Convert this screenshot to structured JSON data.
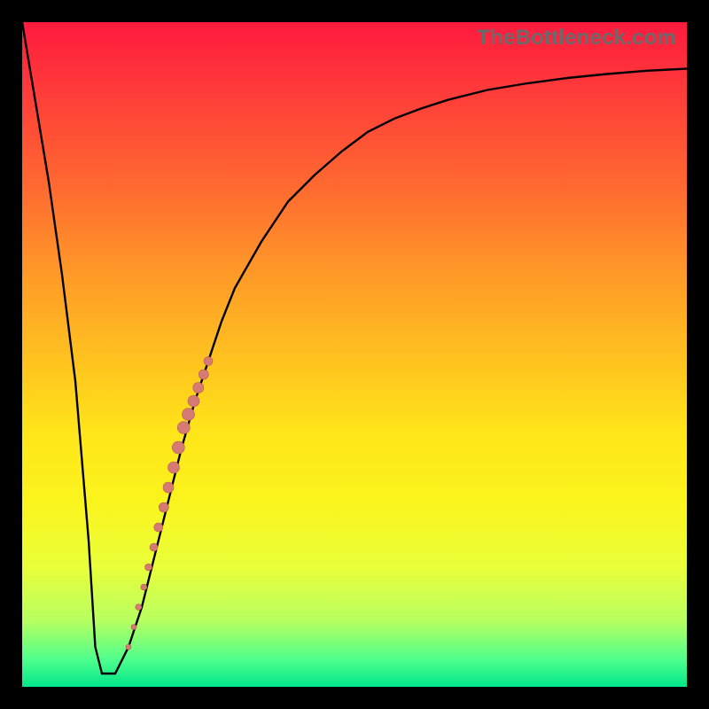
{
  "watermark": "TheBottleneck.com",
  "colors": {
    "curve_stroke": "#000000",
    "dot_fill": "#d67a74",
    "dot_stroke": "#b35a54",
    "background_gradient_top": "#ff1a3e",
    "background_gradient_bottom": "#00e68a",
    "frame": "#000000"
  },
  "chart_data": {
    "type": "line",
    "title": "",
    "xlabel": "",
    "ylabel": "",
    "xlim": [
      0,
      100
    ],
    "ylim": [
      0,
      100
    ],
    "grid": false,
    "legend": false,
    "series": [
      {
        "name": "bottleneck-curve",
        "x": [
          0,
          2,
          4,
          6,
          8,
          10,
          11,
          12,
          14,
          16,
          18,
          20,
          22,
          24,
          26,
          28,
          30,
          32,
          36,
          40,
          44,
          48,
          52,
          56,
          60,
          64,
          70,
          76,
          82,
          88,
          94,
          100
        ],
        "y": [
          100,
          88,
          76,
          62,
          46,
          22,
          6,
          2,
          2,
          6,
          12,
          20,
          28,
          36,
          43,
          49,
          55,
          60,
          67,
          73,
          77,
          80.5,
          83.5,
          85.5,
          87,
          88.3,
          89.8,
          90.8,
          91.6,
          92.2,
          92.7,
          93
        ]
      }
    ],
    "dot_cluster": {
      "note": "salmon dots along rising branch of curve, roughly x 16–28",
      "points": [
        {
          "x": 16.0,
          "y": 6,
          "r": 3
        },
        {
          "x": 16.8,
          "y": 9,
          "r": 3
        },
        {
          "x": 17.5,
          "y": 12,
          "r": 3.5
        },
        {
          "x": 18.3,
          "y": 15,
          "r": 3.5
        },
        {
          "x": 19.0,
          "y": 18,
          "r": 4
        },
        {
          "x": 19.8,
          "y": 21,
          "r": 4.5
        },
        {
          "x": 20.5,
          "y": 24,
          "r": 5
        },
        {
          "x": 21.3,
          "y": 27,
          "r": 5.5
        },
        {
          "x": 22.0,
          "y": 30,
          "r": 6
        },
        {
          "x": 22.8,
          "y": 33,
          "r": 6.5
        },
        {
          "x": 23.5,
          "y": 36,
          "r": 7
        },
        {
          "x": 24.3,
          "y": 39,
          "r": 7
        },
        {
          "x": 25.0,
          "y": 41,
          "r": 7
        },
        {
          "x": 25.8,
          "y": 43,
          "r": 6.5
        },
        {
          "x": 26.5,
          "y": 45,
          "r": 6
        },
        {
          "x": 27.3,
          "y": 47,
          "r": 5.5
        },
        {
          "x": 28.0,
          "y": 49,
          "r": 5
        }
      ]
    }
  }
}
